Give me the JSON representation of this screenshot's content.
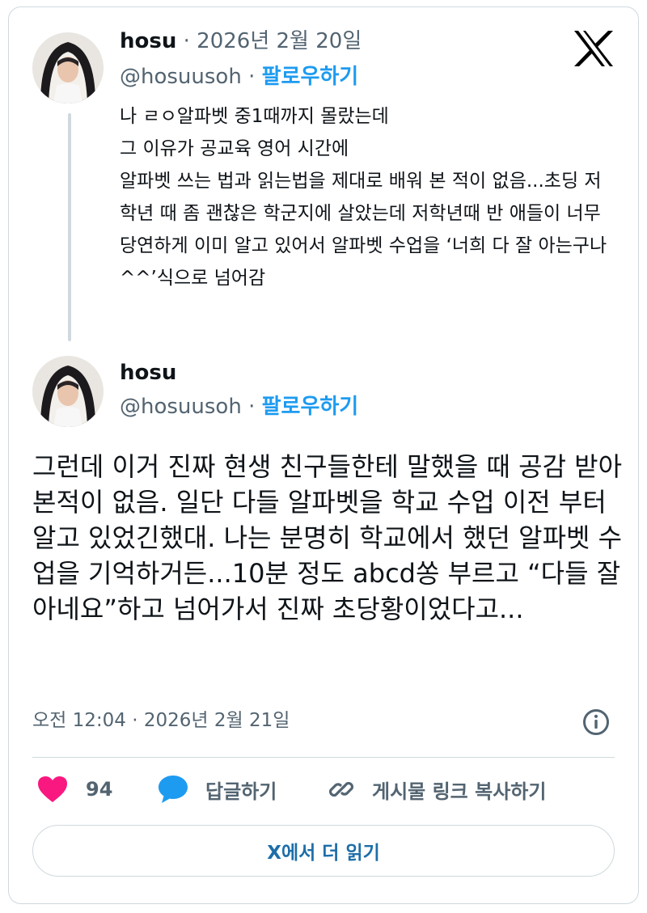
{
  "tweet1": {
    "name": "hosu",
    "date": "· 2026년 2월 20일",
    "handle": "@hosuusoh",
    "sep": "·",
    "follow": "팔로우하기",
    "text": "나 ㄹㅇ알파벳 중1때까지 몰랐는데\n그 이유가 공교육 영어 시간에\n알파벳 쓰는 법과 읽는법을 제대로 배워 본 적이 없음...초딩 저학년 때 좀 괜찮은 학군지에 살았는데 저학년때 반 애들이 너무 당연하게 이미 알고 있어서 알파벳 수업을 ‘너희 다 잘 아는구나^^’식으로 넘어감"
  },
  "tweet2": {
    "name": "hosu",
    "handle": "@hosuusoh",
    "sep": "·",
    "follow": "팔로우하기",
    "text": "그런데 이거 진짜 현생 친구들한테 말했을 때 공감 받아본적이 없음. 일단 다들 알파벳을 학교 수업 이전 부터 알고 있었긴했대. 나는 분명히 학교에서 했던 알파벳 수업을 기억하거든...10분 정도 abcd쏭 부르고 “다들 잘 아네요”하고 넘어가서 진짜 초당황이었다고...",
    "timestamp": "오전 12:04 · 2026년 2월 21일"
  },
  "actions": {
    "likes": "94",
    "reply": "답글하기",
    "copy_link": "게시물 링크 복사하기"
  },
  "read_more": "X에서 더 읽기",
  "icons": {
    "logo": "x-logo-icon",
    "info": "info-icon",
    "like": "heart-icon",
    "reply": "speech-bubble-icon",
    "link": "link-icon"
  },
  "colors": {
    "accent": "#1d9bf0",
    "heart": "#f91880",
    "text": "#0f1419",
    "secondary": "#536471",
    "border": "#cfd9de"
  }
}
